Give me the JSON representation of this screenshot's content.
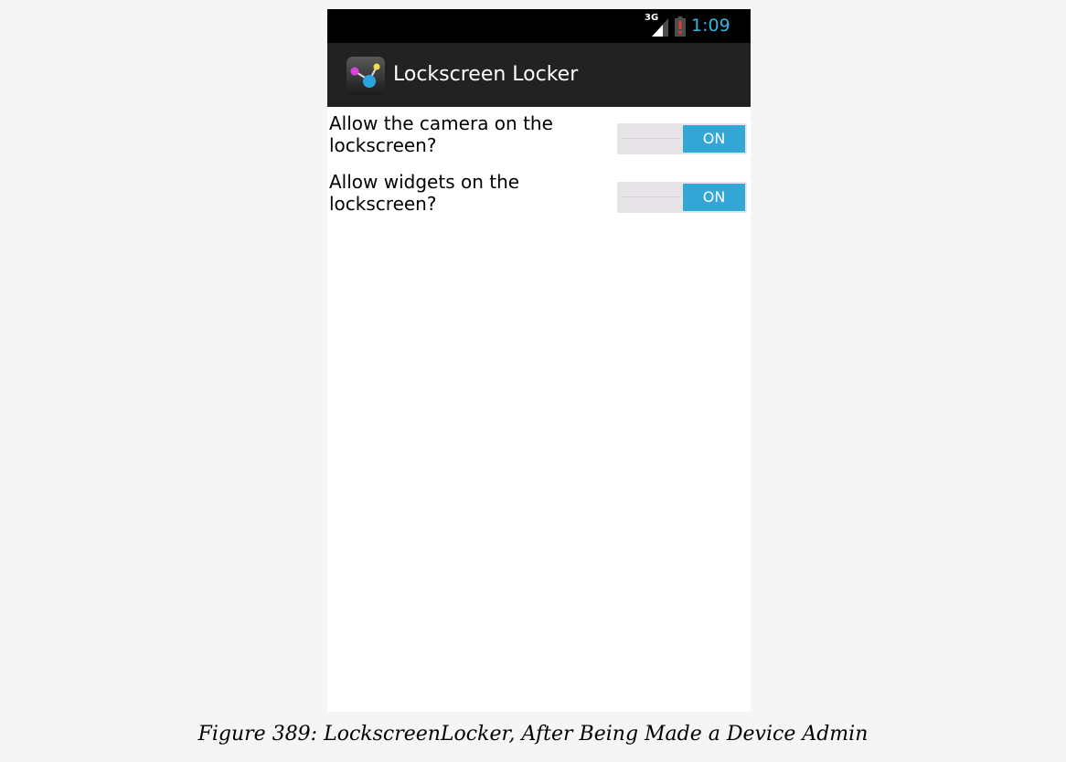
{
  "status_bar": {
    "network": "3G",
    "time": "1:09",
    "time_color": "#33b5e5",
    "battery_alert_color": "#e53935",
    "icons": [
      "signal-icon",
      "battery-alert-icon"
    ]
  },
  "action_bar": {
    "title": "Lockscreen Locker",
    "icon": "app-icon",
    "background": "#222222"
  },
  "settings": [
    {
      "label": "Allow the camera on the lockscreen?",
      "state": "ON"
    },
    {
      "label": "Allow widgets on the lockscreen?",
      "state": "ON"
    }
  ],
  "switch_accent": "#33a7d6",
  "caption": "Figure 389: LockscreenLocker, After Being Made a Device Admin"
}
